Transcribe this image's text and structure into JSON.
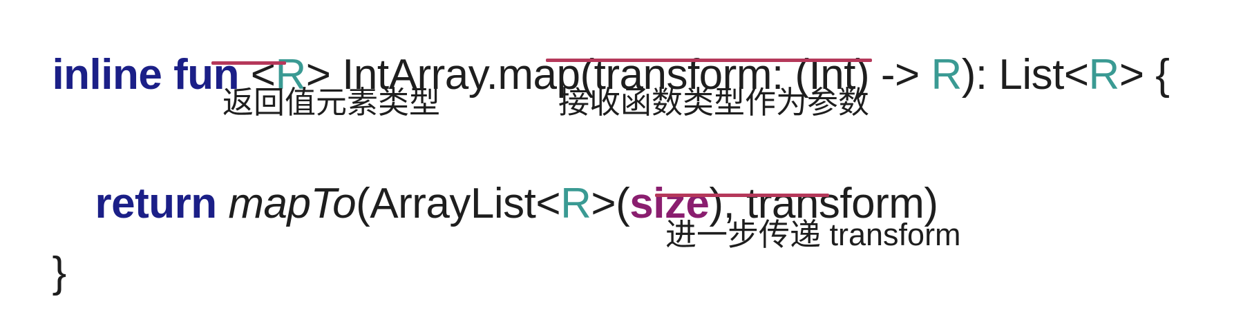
{
  "code": {
    "line1": {
      "kw_inline": "inline",
      "kw_fun": "fun",
      "lt1": "<",
      "typeR1": "R",
      "gt1": ">",
      "signature_mid": "IntArray.map(",
      "param_transform": "transform: (Int) ->",
      "typeR2": "R",
      "close_ret": "): List<",
      "typeR3": "R",
      "brace_open": "> {"
    },
    "line2": {
      "kw_return": "return",
      "fn_mapTo": "mapTo",
      "paren_arraylist": "(ArrayList<",
      "typeR": "R",
      "gt_paren": ">(",
      "prop_size": "size",
      "comma": "), ",
      "arg_transform": "transform",
      "close_paren": ")"
    },
    "line3": {
      "brace_close": "}"
    }
  },
  "annotations": {
    "return_type": "返回值元素类型",
    "function_param": "接收函数类型作为参数",
    "pass_transform": "进一步传递 transform"
  },
  "colors": {
    "keyword": "#1b1f87",
    "type_param": "#3a9a93",
    "property": "#8a1e6f",
    "underline": "#b5385a",
    "text": "#1e1e1e"
  }
}
